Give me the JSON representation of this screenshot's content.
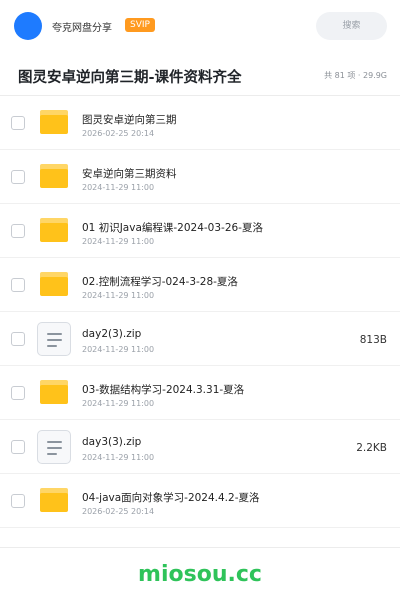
{
  "header": {
    "avatar_color": "#1e7bff",
    "brand": "夸克网盘分享",
    "badge": "SVIP",
    "search_placeholder": "搜索"
  },
  "title_bar": {
    "title": "图灵安卓逆向第三期-课件资料齐全",
    "meta": "共 81 项 · 29.9G"
  },
  "files": [
    {
      "type": "folder",
      "name": "图灵安卓逆向第三期",
      "date": "2026-02-25 20:14",
      "size": ""
    },
    {
      "type": "folder",
      "name": "安卓逆向第三期资料",
      "date": "2024-11-29 11:00",
      "size": ""
    },
    {
      "type": "folder",
      "name": "01 初识Java编程课-2024-03-26-夏洛",
      "date": "2024-11-29 11:00",
      "size": ""
    },
    {
      "type": "folder",
      "name": "02.控制流程学习-024-3-28-夏洛",
      "date": "2024-11-29 11:00",
      "size": ""
    },
    {
      "type": "file",
      "name": "day2(3).zip",
      "date": "2024-11-29 11:00",
      "size": "813B"
    },
    {
      "type": "folder",
      "name": "03-数据结构学习-2024.3.31-夏洛",
      "date": "2024-11-29 11:00",
      "size": ""
    },
    {
      "type": "file",
      "name": "day3(3).zip",
      "date": "2024-11-29 11:00",
      "size": "2.2KB"
    },
    {
      "type": "folder",
      "name": "04-java面向对象学习-2024.4.2-夏洛",
      "date": "2026-02-25 20:14",
      "size": ""
    }
  ],
  "watermark": "miosou.cc",
  "colors": {
    "accent": "#1e7bff",
    "folder": "#ffc21a",
    "badge": "#ff9a1f",
    "watermark": "#2fc35a"
  }
}
